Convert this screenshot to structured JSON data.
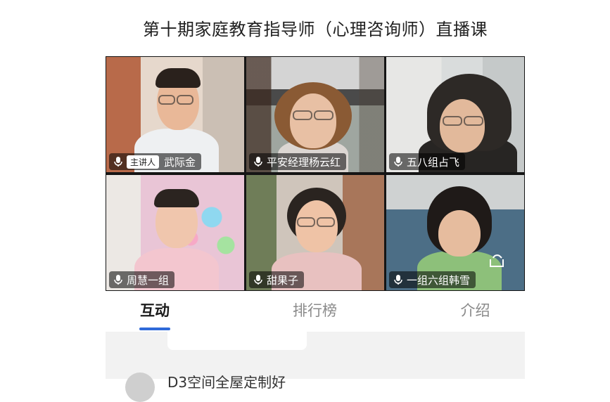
{
  "title": "第十期家庭教育指导师（心理咨询师）直播课",
  "participants": [
    {
      "name": "武际金",
      "badge": "主讲人",
      "mic": "mic-icon"
    },
    {
      "name": "平安经理杨云红",
      "badge": "",
      "mic": "mic-icon"
    },
    {
      "name": "五八组占飞",
      "badge": "",
      "mic": "mic-icon"
    },
    {
      "name": "周慧一组",
      "badge": "",
      "mic": "mic-icon"
    },
    {
      "name": "甜果子",
      "badge": "",
      "mic": "mic-icon"
    },
    {
      "name": "一组六组韩雪",
      "badge": "",
      "mic": "mic-icon"
    }
  ],
  "tabs": [
    {
      "label": "互动",
      "active": true
    },
    {
      "label": "排行榜",
      "active": false
    },
    {
      "label": "介绍",
      "active": false
    }
  ],
  "chat": {
    "partial_message": "D3空间全屋定制好"
  },
  "colors": {
    "accent": "#2f6ad9",
    "panel_bg": "#f2f2f2"
  }
}
